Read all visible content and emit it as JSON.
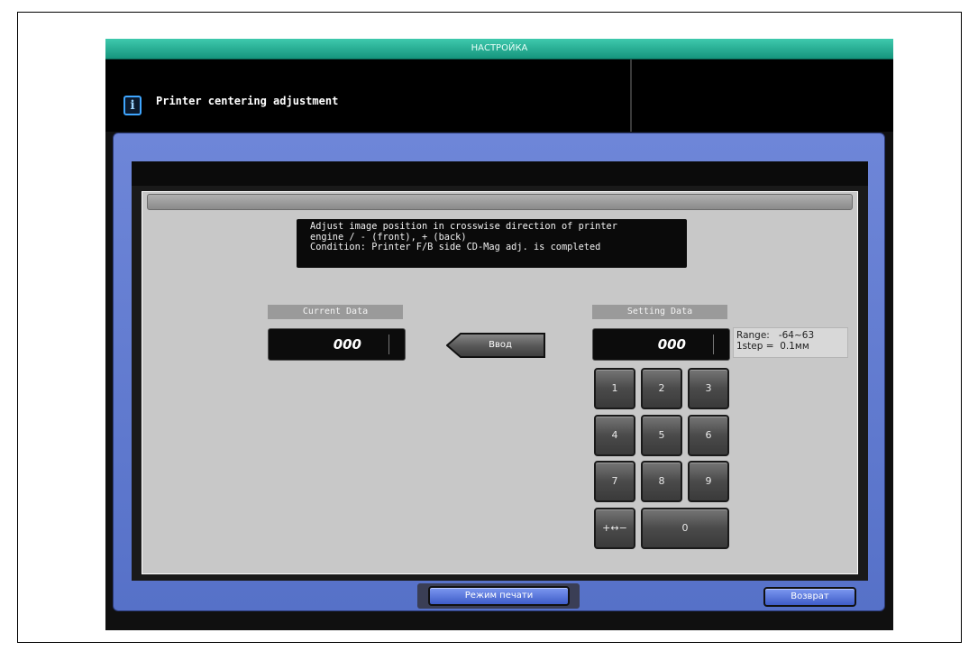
{
  "window": {
    "title": "НАСТРОЙКА"
  },
  "header": {
    "info_icon": "info-icon",
    "title": "Printer centering adjustment"
  },
  "description": {
    "lines": [
      "Adjust image position in crosswise direction of printer",
      "engine / - (front), + (back)",
      "Condition: Printer F/B side CD-Mag adj. is completed"
    ]
  },
  "current": {
    "label": "Current Data",
    "value": "000"
  },
  "enter_button": {
    "label": "Ввод"
  },
  "setting": {
    "label": "Setting Data",
    "value": "000",
    "range_line": "Range:   -64~63",
    "step_line": "1step =  0.1мм"
  },
  "keypad": {
    "k1": "1",
    "k2": "2",
    "k3": "3",
    "k4": "4",
    "k5": "5",
    "k6": "6",
    "k7": "7",
    "k8": "8",
    "k9": "9",
    "sign": "+↔−",
    "k0": "0"
  },
  "footer": {
    "print_mode": "Режим печати",
    "back": "Возврат"
  },
  "colors": {
    "titlebar": "#27b093",
    "panel_blue": "#5f7bd0",
    "button_blue": "#4f6ee0",
    "content_gray": "#c8c8c8"
  }
}
